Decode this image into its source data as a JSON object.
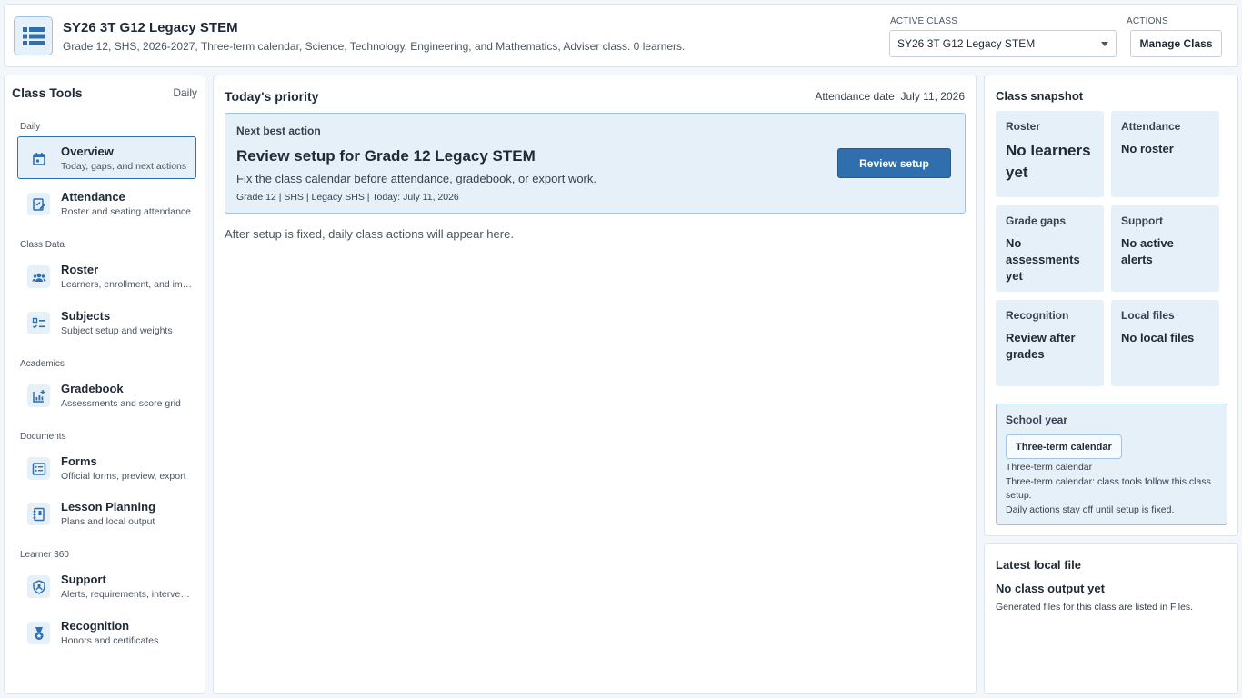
{
  "header": {
    "title": "SY26 3T G12 Legacy STEM",
    "subtitle": "Grade 12, SHS, 2026-2027, Three-term calendar, Science, Technology, Engineering, and Mathematics, Adviser class. 0 learners.",
    "active_class_caption": "ACTIVE CLASS",
    "active_class_value": "SY26 3T G12 Legacy STEM",
    "actions_caption": "ACTIONS",
    "manage_label": "Manage Class"
  },
  "sidebar": {
    "title": "Class Tools",
    "badge": "Daily",
    "groups": [
      "Daily",
      "Class Data",
      "Academics",
      "Documents",
      "Learner 360"
    ],
    "items": [
      {
        "label": "Overview",
        "desc": "Today, gaps, and next actions",
        "icon": "calendar-icon"
      },
      {
        "label": "Attendance",
        "desc": "Roster and seating attendance",
        "icon": "edit-checklist-icon"
      },
      {
        "label": "Roster",
        "desc": "Learners, enrollment, and import",
        "icon": "people-icon"
      },
      {
        "label": "Subjects",
        "desc": "Subject setup and weights",
        "icon": "checklist-icon"
      },
      {
        "label": "Gradebook",
        "desc": "Assessments and score grid",
        "icon": "chart-plus-icon"
      },
      {
        "label": "Forms",
        "desc": "Official forms, preview, export",
        "icon": "form-icon"
      },
      {
        "label": "Lesson Planning",
        "desc": "Plans and local output",
        "icon": "notebook-icon"
      },
      {
        "label": "Support",
        "desc": "Alerts, requirements, interventions",
        "icon": "shield-icon"
      },
      {
        "label": "Recognition",
        "desc": "Honors and certificates",
        "icon": "medal-icon"
      }
    ]
  },
  "main": {
    "title": "Today's priority",
    "attendance_date": "Attendance date: July 11, 2026",
    "next_best_action": {
      "caption": "Next best action",
      "title": "Review setup for Grade 12 Legacy STEM",
      "body": "Fix the class calendar before attendance, gradebook, or export work.",
      "meta": "Grade 12 | SHS | Legacy SHS | Today: July 11, 2026",
      "button": "Review setup"
    },
    "note": "After setup is fixed, daily class actions will appear here."
  },
  "snapshot": {
    "title": "Class snapshot",
    "tiles": [
      {
        "caption": "Roster",
        "value": "No learners yet"
      },
      {
        "caption": "Attendance",
        "value": "No roster"
      },
      {
        "caption": "Grade gaps",
        "value": "No assessments yet"
      },
      {
        "caption": "Support",
        "value": "No active alerts"
      },
      {
        "caption": "Recognition",
        "value": "Review after grades"
      },
      {
        "caption": "Local files",
        "value": "No local files"
      }
    ],
    "school_year": {
      "caption": "School year",
      "pill": "Three-term calendar",
      "line1": "Three-term calendar",
      "line2": "Three-term calendar: class tools follow this class setup.",
      "line3": "Daily actions stay off until setup is fixed."
    }
  },
  "latest": {
    "title": "Latest local file",
    "subtitle": "No class output yet",
    "body": "Generated files for this class are listed in Files."
  },
  "colors": {
    "accent": "#2f6fae",
    "tile_bg": "#e6f0f9",
    "border": "#9fc3e2"
  }
}
